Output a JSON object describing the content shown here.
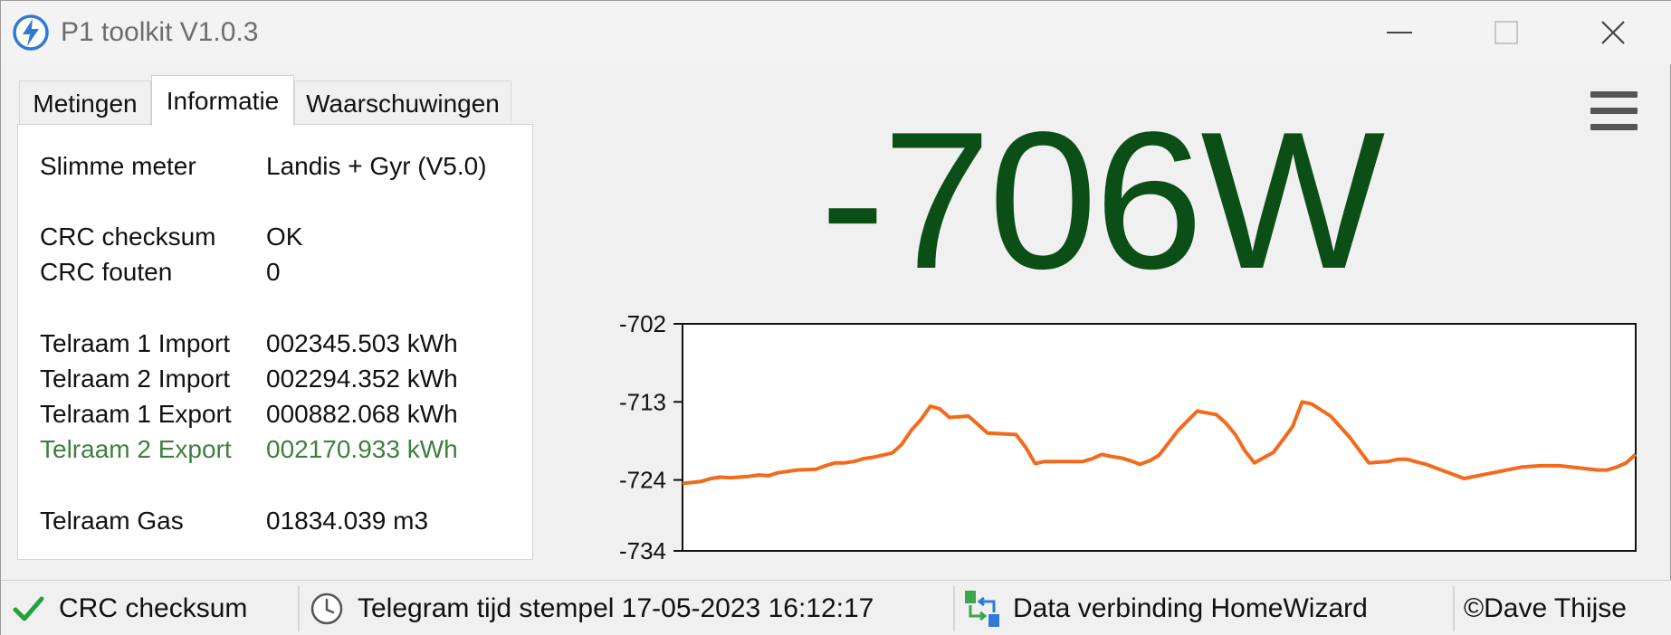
{
  "window": {
    "title": "P1 toolkit V1.0.3"
  },
  "tabs": [
    {
      "label": "Metingen",
      "active": false
    },
    {
      "label": "Informatie",
      "active": true
    },
    {
      "label": "Waarschuwingen",
      "active": false
    }
  ],
  "info": {
    "meter": {
      "label": "Slimme meter",
      "value": "Landis + Gyr (V5.0)"
    },
    "crc_checksum": {
      "label": "CRC checksum",
      "value": "OK"
    },
    "crc_errors": {
      "label": "CRC fouten",
      "value": "0"
    },
    "t1_import": {
      "label": "Telraam 1 Import",
      "value": "002345.503 kWh"
    },
    "t2_import": {
      "label": "Telraam 2 Import",
      "value": "002294.352 kWh"
    },
    "t1_export": {
      "label": "Telraam 1 Export",
      "value": "000882.068 kWh"
    },
    "t2_export": {
      "label": "Telraam 2 Export",
      "value": "002170.933 kWh",
      "highlight_color": "#3f7f3f"
    },
    "gas": {
      "label": "Telraam Gas",
      "value": "01834.039 m3"
    }
  },
  "reading": {
    "value": "-706W",
    "color": "#0b4f17"
  },
  "chart_data": {
    "type": "line",
    "ylim": [
      -734,
      -702
    ],
    "yticks": [
      "-702",
      "-713",
      "-724",
      "-734"
    ],
    "grid": false,
    "line_color": "#f26a1b",
    "x": [
      0,
      2,
      3,
      4,
      5,
      7,
      8,
      9,
      10,
      12,
      14,
      15,
      16,
      17,
      18,
      19,
      20,
      22,
      23,
      24,
      25,
      26,
      27,
      28,
      30,
      32,
      35,
      36,
      37,
      38,
      40,
      42,
      43,
      44,
      45,
      46,
      47,
      48,
      49,
      50,
      52,
      54,
      56,
      57,
      58,
      59,
      60,
      62,
      63,
      64,
      65,
      66,
      68,
      70,
      72,
      74,
      75,
      76,
      78,
      80,
      82,
      85,
      88,
      90,
      92,
      94,
      96,
      97,
      98,
      99,
      100
    ],
    "values": [
      -724.5,
      -724.2,
      -723.8,
      -723.6,
      -723.7,
      -723.5,
      -723.3,
      -723.4,
      -723.0,
      -722.6,
      -722.5,
      -722.0,
      -721.6,
      -721.6,
      -721.4,
      -721.0,
      -720.8,
      -720.2,
      -719.0,
      -717.0,
      -715.5,
      -713.6,
      -714.0,
      -715.2,
      -715.0,
      -717.4,
      -717.6,
      -719.4,
      -721.7,
      -721.4,
      -721.4,
      -721.4,
      -721.0,
      -720.4,
      -720.7,
      -720.9,
      -721.3,
      -721.8,
      -721.3,
      -720.5,
      -717.0,
      -714.3,
      -714.8,
      -716.0,
      -717.6,
      -719.9,
      -721.6,
      -720.1,
      -718.3,
      -716.5,
      -713.0,
      -713.3,
      -715.0,
      -718.0,
      -721.6,
      -721.4,
      -721.1,
      -721.1,
      -721.8,
      -722.8,
      -723.8,
      -723.0,
      -722.2,
      -722.0,
      -722.0,
      -722.3,
      -722.6,
      -722.6,
      -722.2,
      -721.6,
      -720.4
    ]
  },
  "status": {
    "crc": "CRC checksum",
    "timestamp": "Telegram tijd stempel 17-05-2023 16:12:17",
    "connection": "Data verbinding HomeWizard",
    "author": "©Dave Thijse"
  }
}
